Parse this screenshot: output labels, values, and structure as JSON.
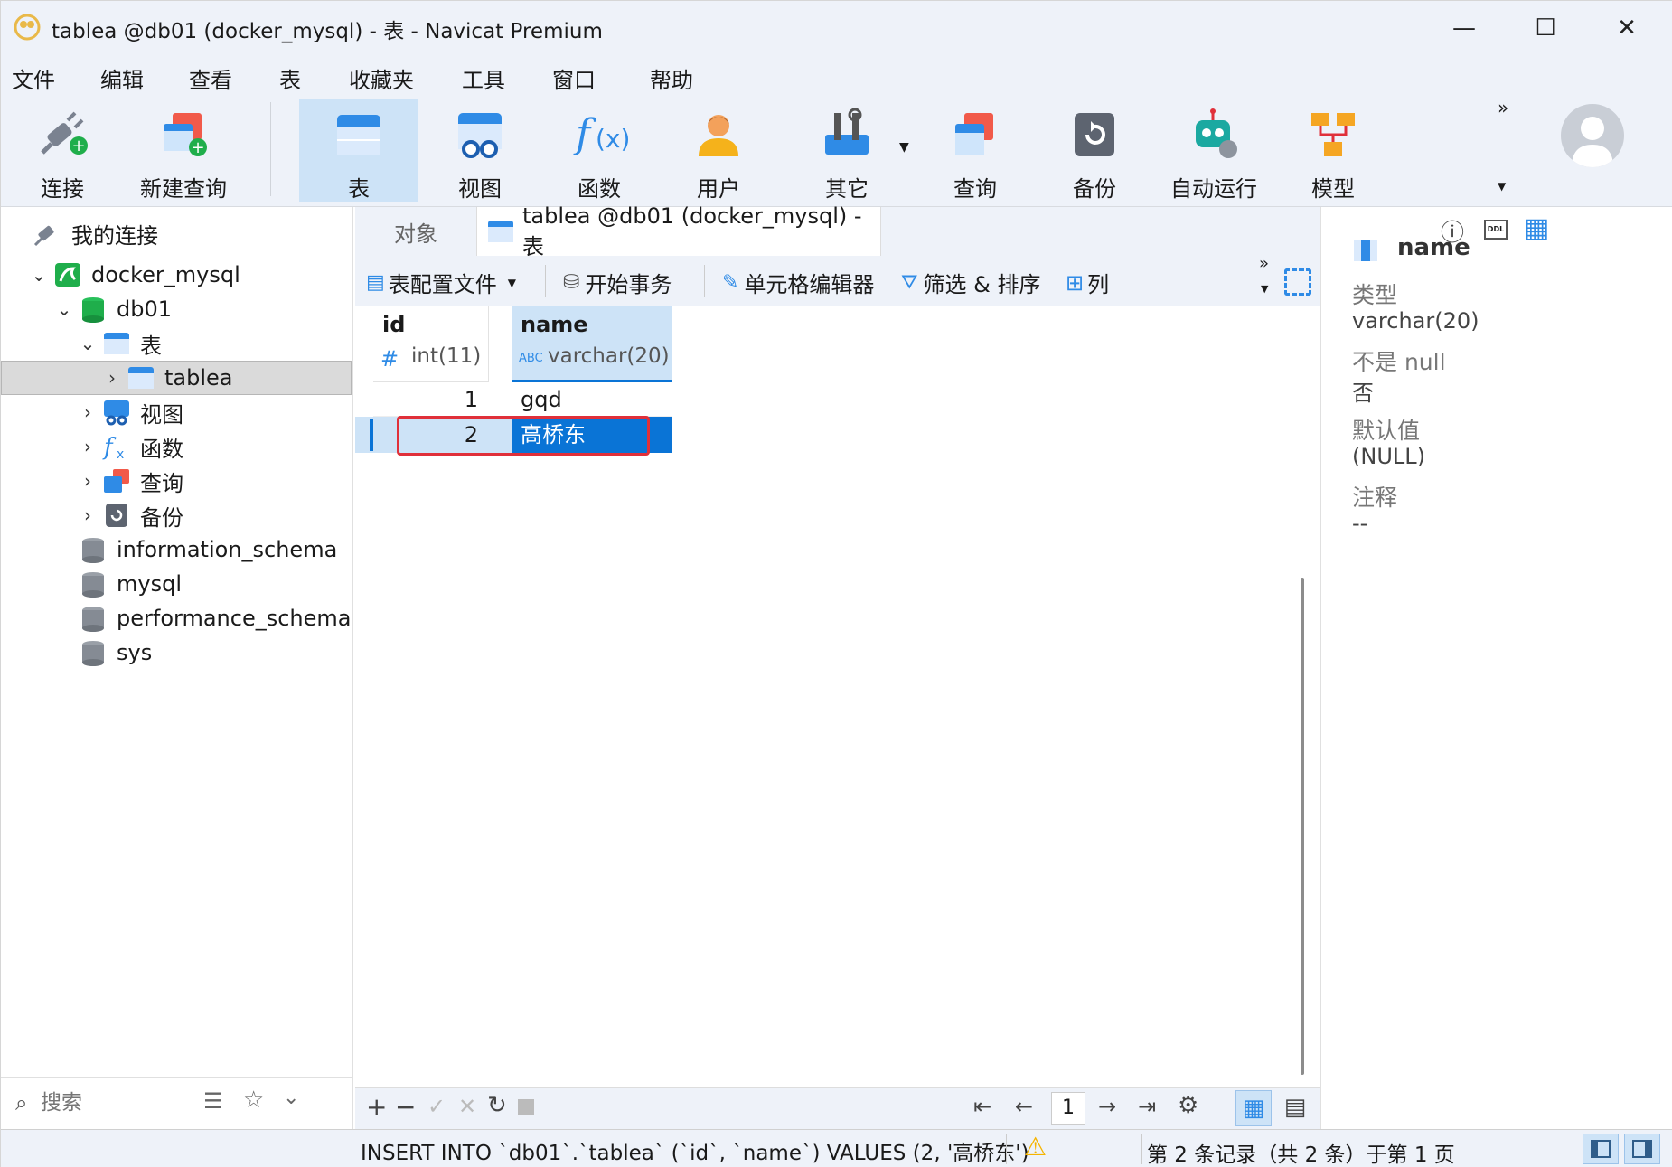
{
  "window": {
    "title": "tablea @db01 (docker_mysql) - 表 - Navicat Premium",
    "minimize": "—",
    "maximize": "☐",
    "close": "✕"
  },
  "menu": [
    "文件",
    "编辑",
    "查看",
    "表",
    "收藏夹",
    "工具",
    "窗口",
    "帮助"
  ],
  "toolbar": {
    "items": [
      {
        "label": "连接",
        "icon": "plug-icon"
      },
      {
        "label": "新建查询",
        "icon": "new-query-icon"
      },
      {
        "label": "表",
        "icon": "table-icon"
      },
      {
        "label": "视图",
        "icon": "view-icon"
      },
      {
        "label": "函数",
        "icon": "function-icon"
      },
      {
        "label": "用户",
        "icon": "user-icon"
      },
      {
        "label": "其它",
        "icon": "tools-icon"
      },
      {
        "label": "查询",
        "icon": "query-icon"
      },
      {
        "label": "备份",
        "icon": "backup-icon"
      },
      {
        "label": "自动运行",
        "icon": "robot-icon"
      },
      {
        "label": "模型",
        "icon": "model-icon"
      }
    ],
    "more": "»"
  },
  "sidebar": {
    "header": "我的连接",
    "connection": "docker_mysql",
    "database": "db01",
    "tables_group": "表",
    "table": "tablea",
    "groups": [
      "视图",
      "函数",
      "查询",
      "备份"
    ],
    "other_dbs": [
      "information_schema",
      "mysql",
      "performance_schema",
      "sys"
    ],
    "search_placeholder": "搜索"
  },
  "tabs": {
    "objects": "对象",
    "active": "tablea @db01 (docker_mysql) - 表"
  },
  "subtoolbar": {
    "profile": "表配置文件",
    "transaction": "开始事务",
    "cell_editor": "单元格编辑器",
    "filter_sort": "筛选 & 排序",
    "columns": "列"
  },
  "grid": {
    "columns": [
      {
        "name": "id",
        "type": "int(11)",
        "type_icon": "#"
      },
      {
        "name": "name",
        "type": "varchar(20)",
        "type_icon": "ABC"
      }
    ],
    "rows": [
      {
        "id": "1",
        "name": "gqd"
      },
      {
        "id": "2",
        "name": "高桥东"
      }
    ]
  },
  "pager": {
    "page": "1"
  },
  "status": {
    "sql": "INSERT INTO `db01`.`tablea` (`id`, `name`) VALUES (2, '高桥东')",
    "record": "第 2 条记录（共 2 条）于第 1 页"
  },
  "inspector": {
    "field": "name",
    "type_label": "类型",
    "type_value": "varchar(20)",
    "notnull_label": "不是 null",
    "notnull_value": "否",
    "default_label": "默认值",
    "default_value": "(NULL)",
    "comment_label": "注释",
    "comment_value": "--"
  },
  "colors": {
    "accent": "#0a74d6",
    "selected_row": "#cde3f7",
    "highlight": "#e0303a"
  }
}
